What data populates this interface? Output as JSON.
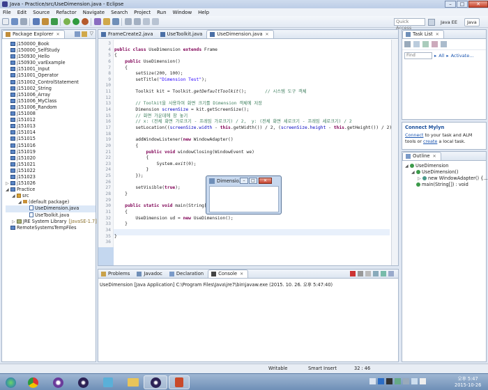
{
  "window": {
    "title": "Java - Practice/src/UseDimension.java - Eclipse",
    "min": "–",
    "max": "□",
    "close": "✕"
  },
  "menu": [
    "File",
    "Edit",
    "Source",
    "Refactor",
    "Navigate",
    "Search",
    "Project",
    "Run",
    "Window",
    "Help"
  ],
  "toolbar": {
    "quick_access_placeholder": "Quick Access",
    "perspectives": [
      "Java EE",
      "Java"
    ]
  },
  "package_explorer": {
    "tab_label": "Package Explorer",
    "items": [
      {
        "label": "j150000_Book",
        "level": 0,
        "kind": "project"
      },
      {
        "label": "j150000_SelfStudy",
        "level": 0,
        "kind": "project"
      },
      {
        "label": "j150930_Hello",
        "level": 0,
        "kind": "project"
      },
      {
        "label": "j150930_varExample",
        "level": 0,
        "kind": "project"
      },
      {
        "label": "j151001_Input",
        "level": 0,
        "kind": "project"
      },
      {
        "label": "j151001_Operator",
        "level": 0,
        "kind": "project"
      },
      {
        "label": "j151002_ControlStatement",
        "level": 0,
        "kind": "project"
      },
      {
        "label": "j151002_String",
        "level": 0,
        "kind": "project"
      },
      {
        "label": "j151006_Array",
        "level": 0,
        "kind": "project"
      },
      {
        "label": "j151006_MyClass",
        "level": 0,
        "kind": "project"
      },
      {
        "label": "j151006_Random",
        "level": 0,
        "kind": "project"
      },
      {
        "label": "j151008",
        "level": 0,
        "kind": "project"
      },
      {
        "label": "j151012",
        "level": 0,
        "kind": "project"
      },
      {
        "label": "j151013",
        "level": 0,
        "kind": "project"
      },
      {
        "label": "j151014",
        "level": 0,
        "kind": "project"
      },
      {
        "label": "j151015",
        "level": 0,
        "kind": "project"
      },
      {
        "label": "j151016",
        "level": 0,
        "kind": "project"
      },
      {
        "label": "j151019",
        "level": 0,
        "kind": "project"
      },
      {
        "label": "j151020",
        "level": 0,
        "kind": "project"
      },
      {
        "label": "j151021",
        "level": 0,
        "kind": "project"
      },
      {
        "label": "j151022",
        "level": 0,
        "kind": "project"
      },
      {
        "label": "j151023",
        "level": 0,
        "kind": "project"
      },
      {
        "label": "j151026",
        "level": 0,
        "kind": "project-collapsed"
      },
      {
        "label": "Practice",
        "level": 0,
        "kind": "project-open"
      },
      {
        "label": "src",
        "level": 1,
        "kind": "folder-open"
      },
      {
        "label": "(default package)",
        "level": 2,
        "kind": "package"
      },
      {
        "label": "UseDimension.java",
        "level": 3,
        "kind": "java"
      },
      {
        "label": "UseToolkit.java",
        "level": 3,
        "kind": "java"
      },
      {
        "label": "JRE System Library",
        "suffix": "[JavaSE-1.7]",
        "level": 1,
        "kind": "library"
      },
      {
        "label": "RemoteSystemsTempFiles",
        "level": 0,
        "kind": "project"
      }
    ]
  },
  "editor": {
    "tabs": [
      {
        "label": "FrameCreate2.java",
        "active": false
      },
      {
        "label": "UseToolkit.java",
        "active": false
      },
      {
        "label": "UseDimension.java",
        "active": true
      }
    ],
    "lines": [
      {
        "n": "3",
        "html": ""
      },
      {
        "n": "4",
        "html": "<span class=\"kw\">public class</span> UseDimension <span class=\"kw\">extends</span> Frame"
      },
      {
        "n": "5",
        "html": "{"
      },
      {
        "n": "6",
        "html": "    <span class=\"kw\">public</span> UseDimension()"
      },
      {
        "n": "7",
        "html": "    {"
      },
      {
        "n": "8",
        "html": "        setSize(200, 100);"
      },
      {
        "n": "9",
        "html": "        setTitle(<span class=\"str\">\"Dimension Test\"</span>);"
      },
      {
        "n": "10",
        "html": ""
      },
      {
        "n": "11",
        "html": "        Toolkit kit = Toolkit.<span class=\"it\">getDefaultToolkit</span>();       <span class=\"cm\">// 시스템 도구 객체</span>"
      },
      {
        "n": "12",
        "html": ""
      },
      {
        "n": "13",
        "html": "        <span class=\"cm\">// Toolkit을 사용하여 화면 크기를 Dimension 객체에 저장</span>"
      },
      {
        "n": "14",
        "html": "        Dimension <span class=\"fld\">screenSize</span> = kit.getScreenSize();"
      },
      {
        "n": "15",
        "html": "        <span class=\"cm\">// 화면 가운데에 창 놓기</span>"
      },
      {
        "n": "16",
        "html": "        <span class=\"cm\">// x: (전체 화면 가로크기 - 프레임 가로크기) / 2,  y: (전체 화면 세로크기 - 프레임 세로크기) / 2</span>"
      },
      {
        "n": "17",
        "html": "        setLocation((<span class=\"fld\">screenSize</span>.<span class=\"fld\">width</span> - <span class=\"kw\">this</span>.getWidth()) / 2, (<span class=\"fld\">screenSize</span>.<span class=\"fld\">height</span> - <span class=\"kw\">this</span>.getHeight()) / 2);"
      },
      {
        "n": "18",
        "html": ""
      },
      {
        "n": "19",
        "html": "        addWindowListener(<span class=\"kw\">new</span> WindowAdapter()"
      },
      {
        "n": "20",
        "html": "        {"
      },
      {
        "n": "21",
        "html": "            <span class=\"kw\">public void</span> windowClosing(WindowEvent we)"
      },
      {
        "n": "22",
        "html": "            {"
      },
      {
        "n": "23",
        "html": "                System.<span class=\"it\">exit</span>(0);"
      },
      {
        "n": "24",
        "html": "            }"
      },
      {
        "n": "25",
        "html": "        });"
      },
      {
        "n": "26",
        "html": ""
      },
      {
        "n": "27",
        "html": "        setVisible(<span class=\"kw\">true</span>);"
      },
      {
        "n": "28",
        "html": "    }"
      },
      {
        "n": "29",
        "html": ""
      },
      {
        "n": "30",
        "html": "    <span class=\"kw\">public static void</span> main(String[] args)"
      },
      {
        "n": "31",
        "html": "    {"
      },
      {
        "n": "32",
        "html": "        UseDimension <span class=\"ud\">ud</span> = <span class=\"kw\">new</span> UseDimension();"
      },
      {
        "n": "33",
        "html": "    }"
      },
      {
        "n": "34",
        "html": ""
      },
      {
        "n": "35",
        "html": "}"
      },
      {
        "n": "36",
        "html": ""
      }
    ]
  },
  "bottom_panel": {
    "tabs": [
      "Problems",
      "Javadoc",
      "Declaration",
      "Console"
    ],
    "console_header": "UseDimension [Java Application] C:\\Program Files\\Java\\jre7\\bin\\javaw.exe (2015. 10. 26. 오후 5:47:40)"
  },
  "task_list": {
    "tab_label": "Task List",
    "find_placeholder": "Find",
    "all": "All",
    "activate": "Activate..."
  },
  "mylyn": {
    "title": "Connect Mylyn",
    "text_link1": "Connect",
    "text1": " to your task and ALM tools or ",
    "text_link2": "create",
    "text2": " a local task."
  },
  "outline": {
    "tab_label": "Outline",
    "items": [
      {
        "label": "UseDimension",
        "level": 0
      },
      {
        "label": "UseDimension()",
        "level": 1
      },
      {
        "label": "new WindowAdapter() {...}",
        "level": 2
      },
      {
        "label": "main(String[]) : void",
        "level": 1
      }
    ]
  },
  "dialog": {
    "title": "Dimensio..."
  },
  "status": {
    "writable": "Writable",
    "insert": "Smart Insert",
    "position": "32 : 46"
  },
  "clock": {
    "time": "오후 5:47",
    "date": "2015-10-26"
  }
}
